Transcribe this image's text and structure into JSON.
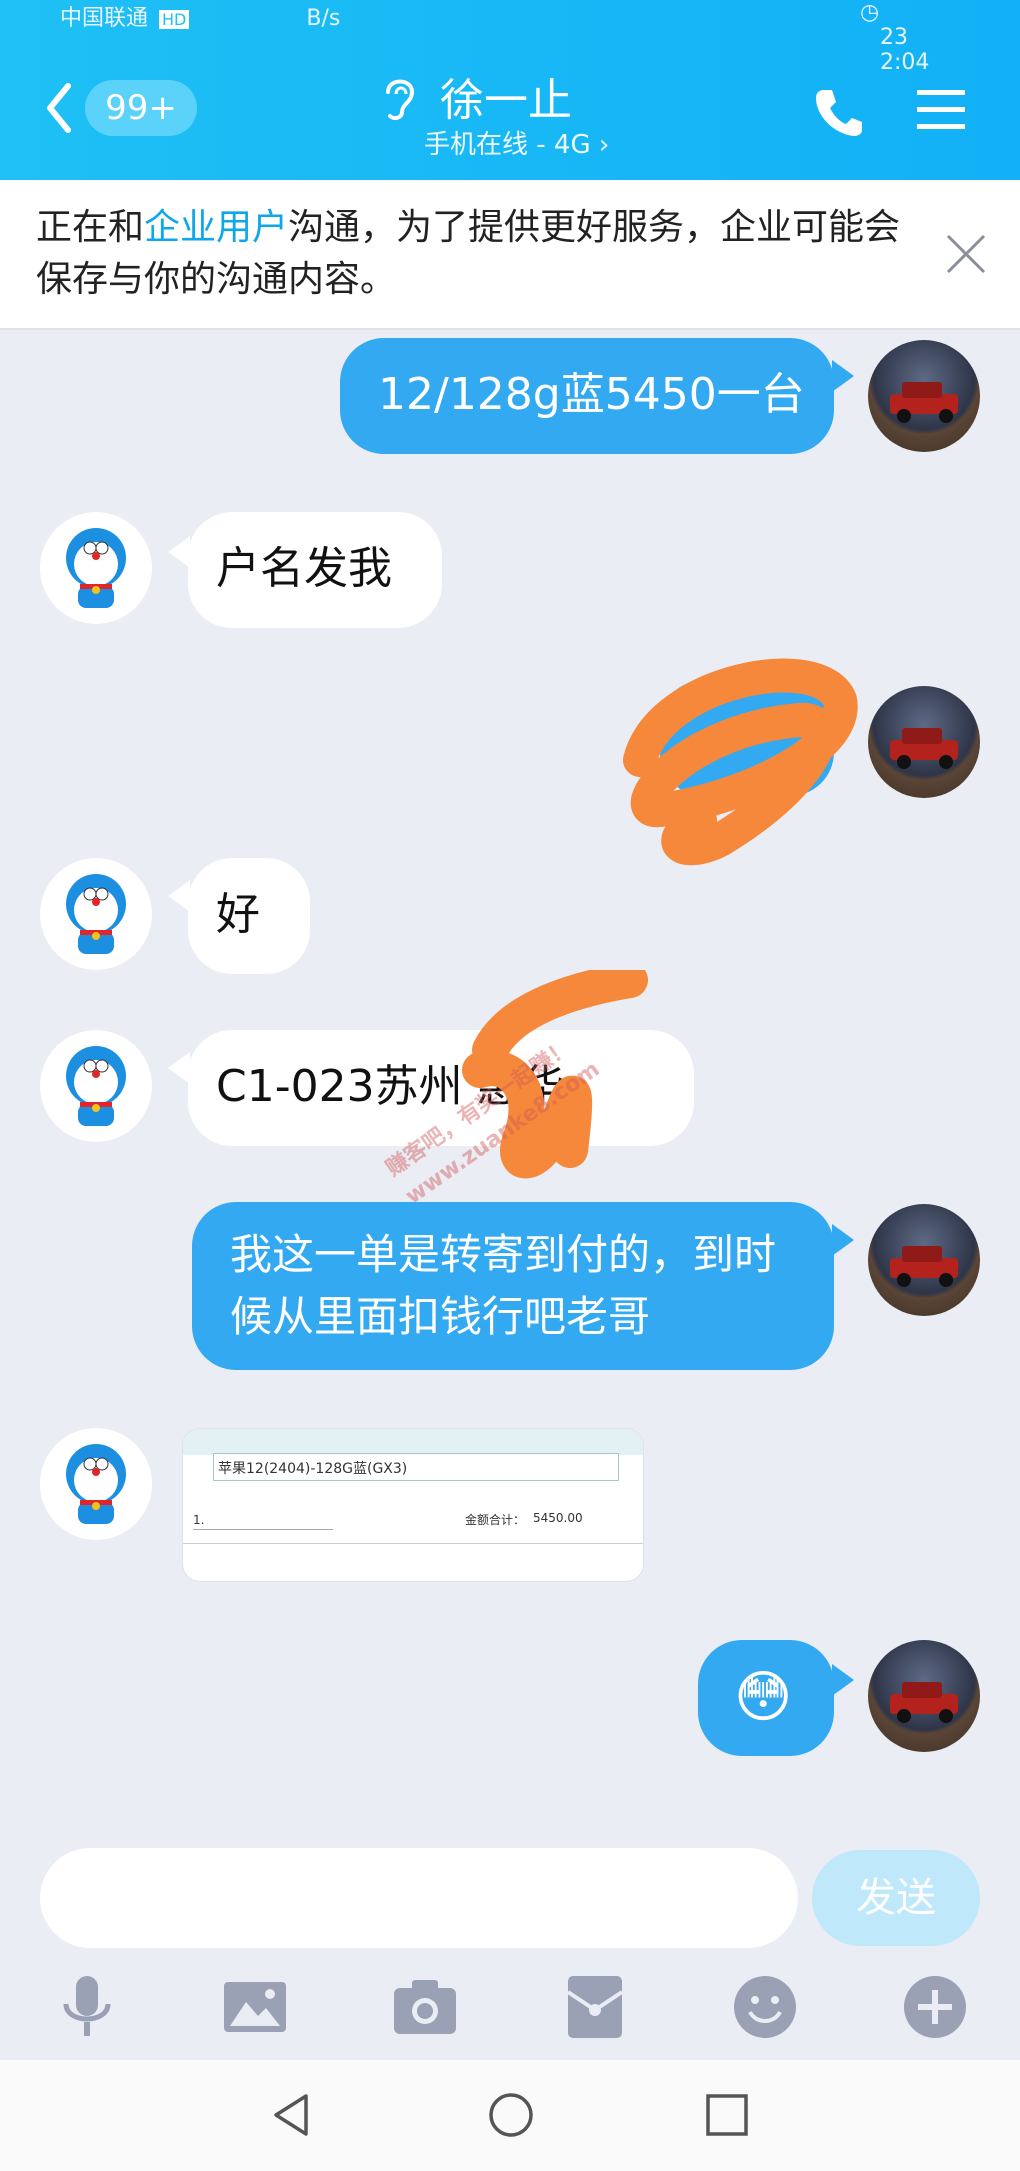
{
  "status_bar": {
    "carrier": "中国联通",
    "hd": "HD",
    "speed": "B/s",
    "battery": "23",
    "time": "2:04"
  },
  "header": {
    "badge": "99+",
    "contact_name": "徐一止",
    "contact_status": "手机在线 - 4G ›"
  },
  "notice": {
    "prefix": "正在和",
    "highlight": "企业用户",
    "suffix": "沟通，为了提供更好服务，企业可能会保存与你的沟通内容。"
  },
  "messages": [
    {
      "side": "right",
      "text": "12/128g蓝5450一台"
    },
    {
      "side": "left",
      "text": "户名发我"
    },
    {
      "side": "right",
      "text": ""
    },
    {
      "side": "left",
      "text": "好"
    },
    {
      "side": "left",
      "text": "C1-023苏州 惠华"
    },
    {
      "side": "right",
      "text": "我这一单是转寄到付的，到时候从里面扣钱行吧老哥"
    },
    {
      "side": "left",
      "image": {
        "product": "苹果12(2404)-128G蓝(GX3)",
        "row_no": "1.",
        "total_label": "金额合计：",
        "total_value": "5450.00"
      }
    },
    {
      "side": "right",
      "emoji": "😳"
    }
  ],
  "watermark": "赚客吧，有奖一起赚！ www.zuanke8.com",
  "composer": {
    "send_label": "发送"
  },
  "toolbar": [
    "mic-icon",
    "image-icon",
    "camera-icon",
    "redpacket-icon",
    "emoji-icon",
    "plus-icon"
  ],
  "colors": {
    "header": "#1ec0f5",
    "bubble_right": "#33a9f2",
    "scribble": "#f5883a"
  }
}
